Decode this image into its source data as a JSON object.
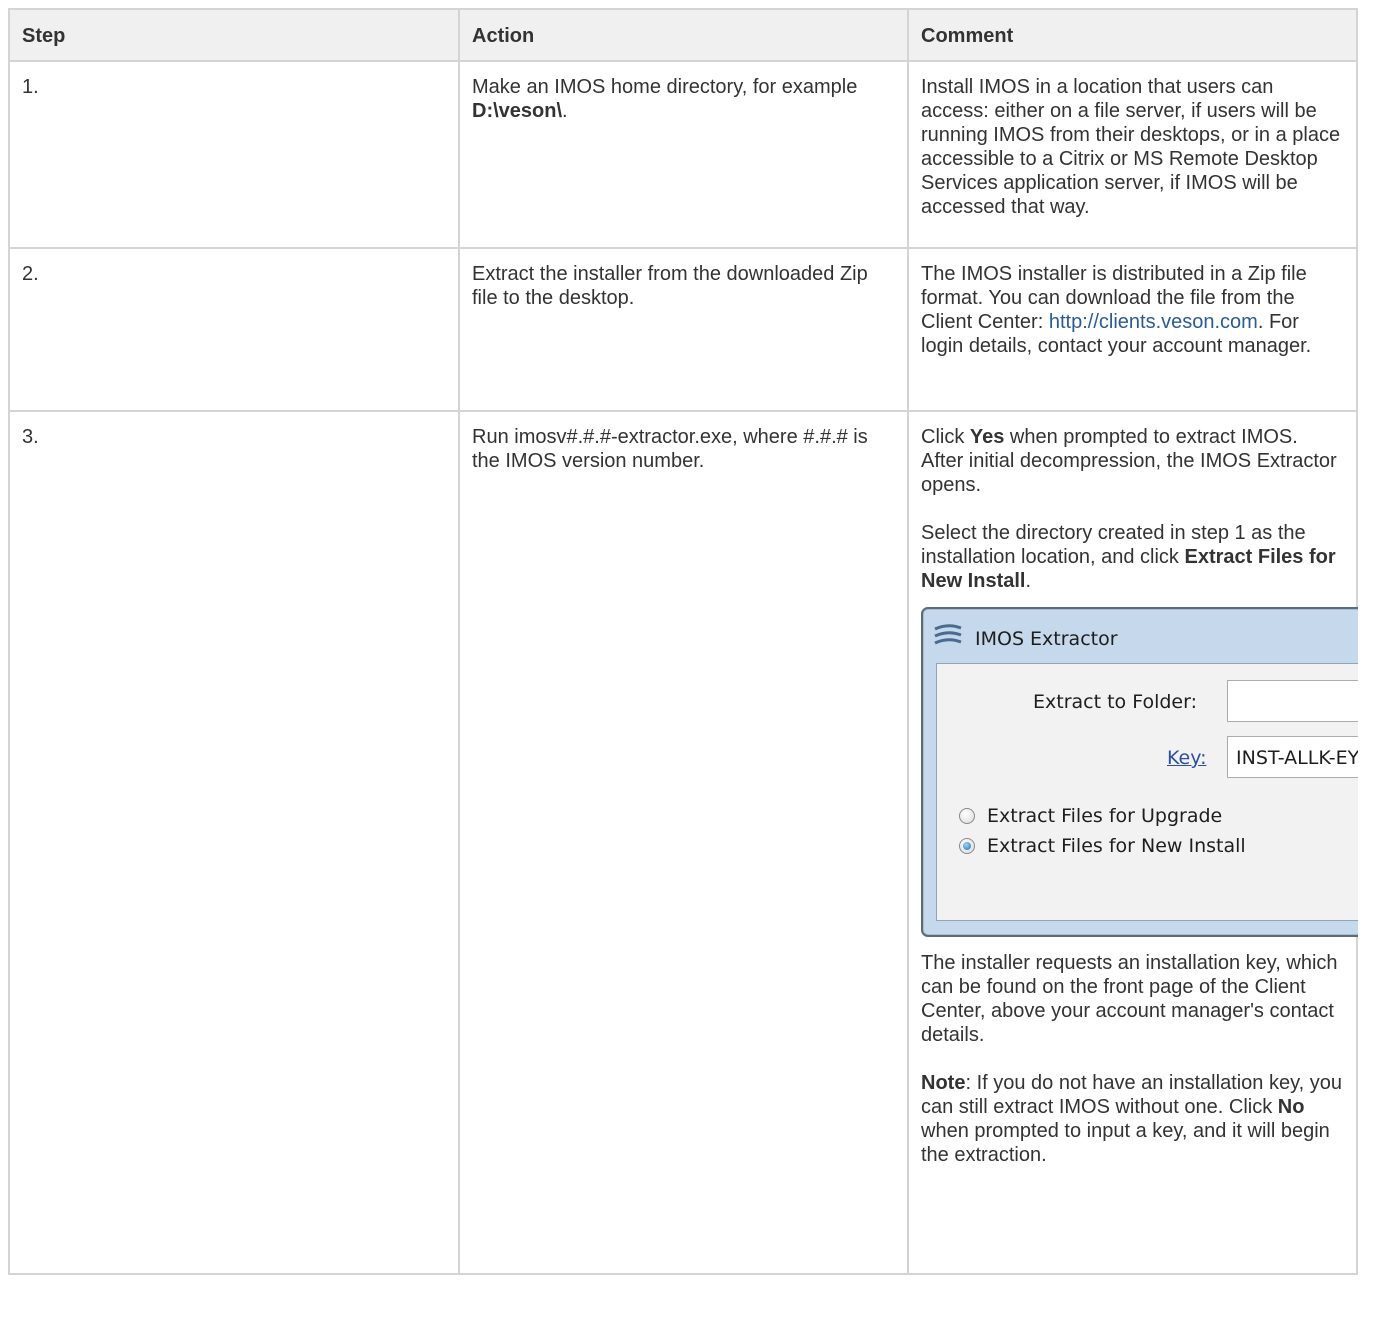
{
  "headers": {
    "step": "Step",
    "action": "Action",
    "comment": "Comment"
  },
  "rows": [
    {
      "step": "1.",
      "action_pre": "Make an IMOS home directory, for example ",
      "action_bold": "D:\\veson\\",
      "action_post": ".",
      "comment": "Install IMOS in a location that users can access: either on a file server, if users will be running IMOS from their desktops, or in a place accessible to a Citrix or MS Remote Desktop Services application server, if IMOS will be accessed that way."
    },
    {
      "step": "2.",
      "action": "Extract the installer from the downloaded Zip file to the desktop.",
      "comment_pre": "The IMOS installer is distributed in a Zip file format. You can download the file from the Client Center: ",
      "comment_link": "http://clients.veson.com",
      "comment_post": ". For login details, contact your account manager."
    },
    {
      "step": "3.",
      "action": "Run imosv#.#.#-extractor.exe, where #.#.# is the IMOS version number.",
      "p1_pre": "Click ",
      "p1_bold": "Yes",
      "p1_post": " when prompted to extract IMOS. After initial decompression, the IMOS Extractor opens.",
      "p2_pre": "Select the directory created in step 1 as the installation location, and click ",
      "p2_bold": "Extract Files for New Install",
      "p2_post": ".",
      "p3": "The installer requests an installation key, which can be found on the front page of the Client Center, above your account manager's contact details.",
      "p4_bold": "Note",
      "p4_post": ": If you do not have an installation key, you can still extract IMOS without one. Click ",
      "p4_bold2": "No",
      "p4_post2": " when prompted to input a key, and it will begin the extraction."
    }
  ],
  "extractor": {
    "title": "IMOS Extractor",
    "folder_label": "Extract to Folder:",
    "folder_value": "",
    "key_label": "Key:",
    "key_value": "INST-ALLK-EY",
    "options": [
      "Extract Files for Upgrade",
      "Extract Files for New Install"
    ],
    "selected_option": "Extract Files for New Install",
    "icon": "imos-logo-icon"
  },
  "colors": {
    "link": "#2a5c93",
    "header_bg": "#f0f0f0",
    "border": "#d4d4d4"
  }
}
